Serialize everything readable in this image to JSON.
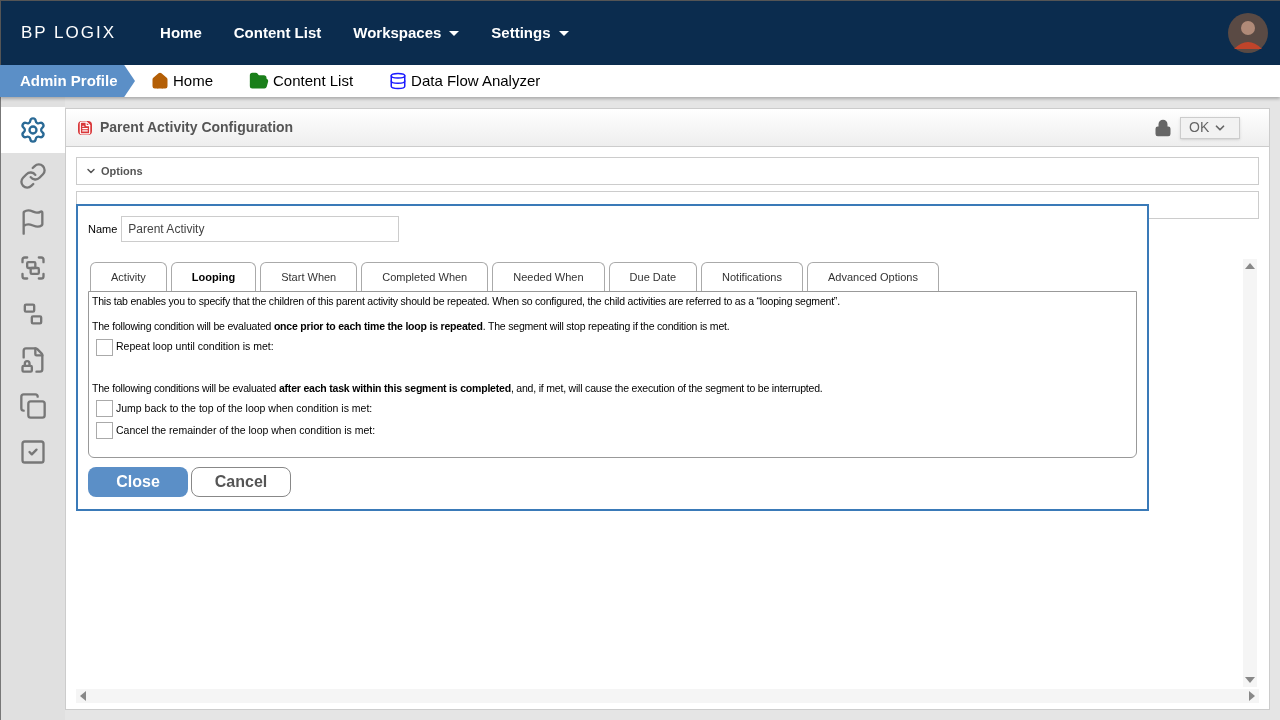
{
  "top_nav": {
    "logo": "BP LOGIX",
    "items": [
      {
        "label": "Home",
        "dropdown": false
      },
      {
        "label": "Content List",
        "dropdown": false
      },
      {
        "label": "Workspaces",
        "dropdown": true
      },
      {
        "label": "Settings",
        "dropdown": true
      }
    ]
  },
  "breadcrumb": {
    "profile": "Admin Profile",
    "links": [
      {
        "label": "Home",
        "kind": "home"
      },
      {
        "label": "Content List",
        "kind": "folder"
      },
      {
        "label": "Data Flow Analyzer",
        "kind": "data"
      }
    ]
  },
  "sidebar": {
    "items": [
      {
        "kind": "gears",
        "selected": true
      },
      {
        "kind": "link",
        "selected": false
      },
      {
        "kind": "flag",
        "selected": false
      },
      {
        "kind": "group",
        "selected": false
      },
      {
        "kind": "ungroup",
        "selected": false
      },
      {
        "kind": "file-lock",
        "selected": false
      },
      {
        "kind": "copy",
        "selected": false
      },
      {
        "kind": "check",
        "selected": false
      }
    ]
  },
  "panel": {
    "title": "Parent Activity Configuration",
    "ok_button": "OK",
    "sections": [
      {
        "label": "Options",
        "expanded": true
      }
    ]
  },
  "dialog": {
    "name_label": "Name",
    "name_value": "Parent Activity",
    "tabs": [
      {
        "label": "Activity",
        "selected": false
      },
      {
        "label": "Looping",
        "selected": true
      },
      {
        "label": "Start When",
        "selected": false
      },
      {
        "label": "Completed When",
        "selected": false
      },
      {
        "label": "Needed When",
        "selected": false
      },
      {
        "label": "Due Date",
        "selected": false
      },
      {
        "label": "Notifications",
        "selected": false
      },
      {
        "label": "Advanced Options",
        "selected": false
      }
    ],
    "intro": "This tab enables you to specify that the children of this parent activity should be repeated. When so configured, the child activities are referred to as a “looping segment”.",
    "groups": [
      {
        "text": "The following condition will be evaluated **once prior to each time the loop is repeated**. The segment will stop repeating if the condition is met.",
        "options": [
          {
            "label": "Repeat loop until condition is met:",
            "checked": false
          }
        ]
      },
      {
        "text": "The following conditions will be evaluated **after each task within this segment is completed**, and, if met, will cause the execution of the segment to be interrupted.",
        "options": [
          {
            "label": "Jump back to the top of the loop when condition is met:",
            "checked": false
          },
          {
            "label": "Cancel the remainder of the loop when condition is met:",
            "checked": false
          }
        ]
      }
    ],
    "buttons": [
      {
        "label": "Close",
        "kind": "primary"
      },
      {
        "label": "Cancel",
        "kind": "secondary"
      }
    ]
  }
}
